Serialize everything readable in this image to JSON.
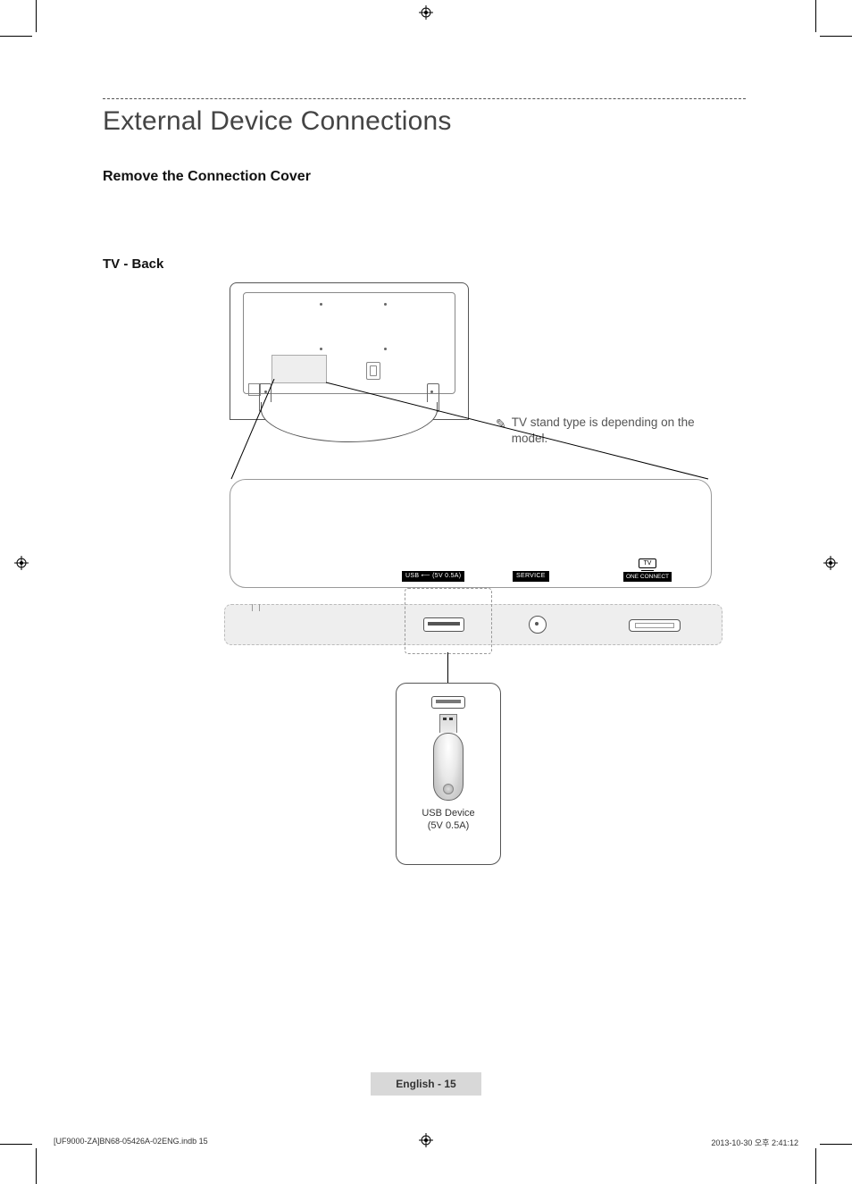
{
  "page_title": "External Device Connections",
  "section_heading": "Remove the Connection Cover",
  "subsection_heading": "TV - Back",
  "note": "TV stand type is depending on the model.",
  "ports": {
    "usb_label": "USB ⟵ (5V 0.5A)",
    "service_label": "SERVICE",
    "one_connect_tv": "TV",
    "one_connect_label": "ONE CONNECT"
  },
  "usb_callout": {
    "line1": "USB Device",
    "line2": "(5V 0.5A)"
  },
  "footer": {
    "language": "English",
    "page_number": "15"
  },
  "meta": {
    "left": "[UF9000-ZA]BN68-05426A-02ENG.indb   15",
    "right": "2013-10-30   오후 2:41:12"
  }
}
